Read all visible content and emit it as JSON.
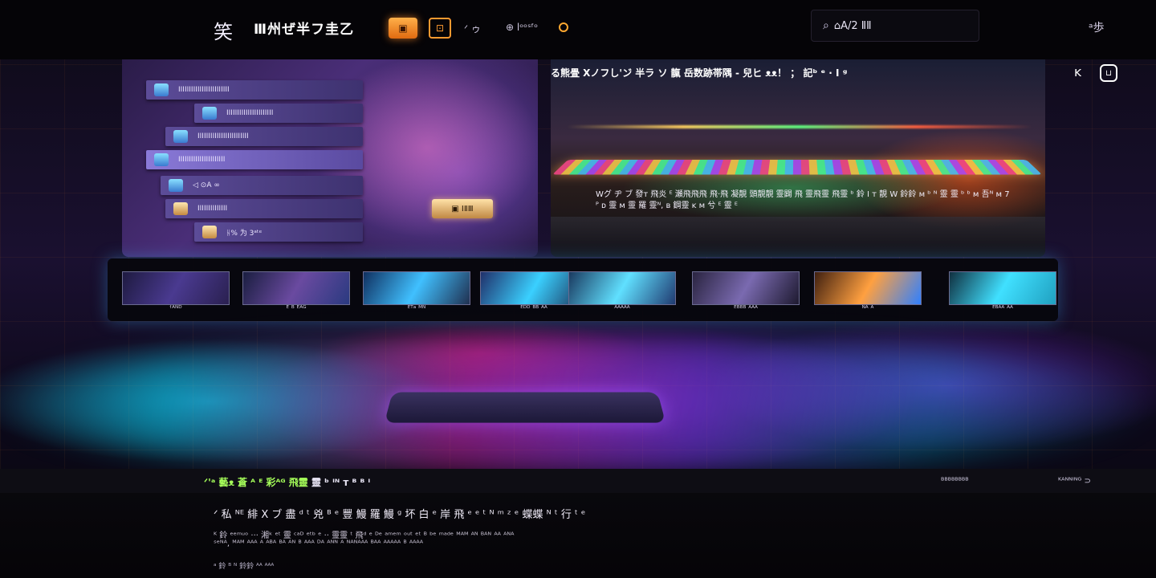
{
  "header": {
    "logo_glyph": "笑",
    "brand": "Ⅲ州ぜ半フ圭乙",
    "badge_primary": "▣",
    "badge_secondary": "⊡",
    "link_a": "ᐟ ゥ",
    "link_b": "⊕ lᵒᵒˢᶠᵒ",
    "search": {
      "value": "⌂A/2 ⅡⅡ",
      "icon": "search-icon"
    },
    "right_label": "ᵃ歩"
  },
  "hero_left": {
    "menu_items": [
      "IIIIIIIIIIIIIIIIIIIIIIII",
      "IIIIIIIIIIIIIIIIIIIIII",
      "IIIIIIIIIIIIIIIIIIIIIIII",
      "IIIIIIIIIIIIIIIIIIIIII",
      "◁ ⊙A ∞",
      "IIIIIIIIIIIIII",
      "ᚺ% 为 3ᵃᵗᵉ"
    ],
    "cta": "▣ ⅠⅡⅢ"
  },
  "hero_right": {
    "title": "る熊畳 Xノフし'ン゙ 半ラ ソ 靝 岳数跡帯隅 - 兒ヒ ᴥᴥ！ ； 記ᵇ ᵉ · Ⅰ ᵍ",
    "desc": "Wグ ヂ ブ 發ᴛ 飛炎 ᴱ 瀬飛飛飛 飛·飛 凝靚 頭靚靚 靈闢 飛 靈飛靈 飛靈 ᵇ 鈴 Ⅰ ᴛ 靚 W 鈴鈴 ᴍ ᵇ ᴺ 靈 靈 ᵇ ᵇ ᴍ 吾ᴺ ᴍ 7 ᴾ ᴅ 靈 ᴍ 靈 羅 靈ᴺ, ʙ 鋼靈 ᴋ ᴍ 兮 ᴱ 靈 ᴱ"
  },
  "controls": {
    "share": "ᴋ",
    "fullscreen": "⊔"
  },
  "carousel": [
    {
      "label": "ᶠᴬᴺᴰ"
    },
    {
      "label": "ᴱ ᴮ ᴱᴬᴳ"
    },
    {
      "label": "ᴱᵀᵃ ᴹᴺ"
    },
    {
      "label": "ᴱᴰᴰ ᴮᴮ ᴬᴬ"
    },
    {
      "label": "ᴬᴬᴬᴬᴬ"
    },
    {
      "label": "ᴱᴮᴮᴮ ᴬᴬᴬ"
    },
    {
      "label": "ᴺᴬ ᴬ"
    },
    {
      "label": "ᴱᴮᴬᴬ ᴬᴬ"
    }
  ],
  "footer": {
    "ticker_highlight": "ᐟ'ᵃ 藝ᴥ 蒼 ᴬ ᴱ 彩ᴬᴳ 飛靈",
    "ticker_rest": " 靈 ᵇ ᴵᴺ ᴛ ᴮ ᴮ ᴵ",
    "more": "ᴮᴮᴮᴮᴮᴮᴮᴮ",
    "lang": "ᴷᴬᴺᴺᴵᴺᴳ ⊃",
    "headline": "ᐟ 私 ᴺᴱ 緋 X ブ 盡 ᵈ ᵗ 兇 ᴮ ᵉ 豐 鰻 羅 鰻 ᵍ 坏 白 ᵉ 岸 飛 ᵉ ᵉ ᵗ ᴺ ᵐ ᶻ ᵉ 蝶蝶 ᴺ ᵗ 行 ᵗ ᵉ",
    "line1": "ᴷ 鈴 ᵉᵉᵐᵘᵒ ··· 湘ᵏ ᵉᵗ 靈 ᶜᵃᴰ ᵉᵗᵇ ᵉ ·· 靈靈 ᵗ 飛ᵈ ᵉ ᴰᵉ ᵃᵐᵉᵐ ᵒᵘᵗ ᵉᵗ ᴮ ᵇᵉ ᵐᵃᵈᵉ ᴹᴬᴹ ᴬᴺ ᴮᴬᴺ ᴬᴬ ᴬᴺᴬ",
    "line2": "ˢᵉᴺᴬ, ᴹᴬᴹ ᴬᴬᴬ ᴬ ᴬᴮᴬ ᴮᴬ ᴬᴺ ᴮ ᴬᴬᴬ ᴰᴬ ᴬᴺᴺ ᴬ ᴺᴬᴺᴬᴬᴬ ᴮᴬᴬ ᴬᴬᴬᴬᴬ ᴮ ᴬᴬᴬᴬ",
    "small": "ᵃ 鈴 ᴮ ᴺ 鈴鈴 ᴬᴬ ᴬᴬᴬ"
  }
}
